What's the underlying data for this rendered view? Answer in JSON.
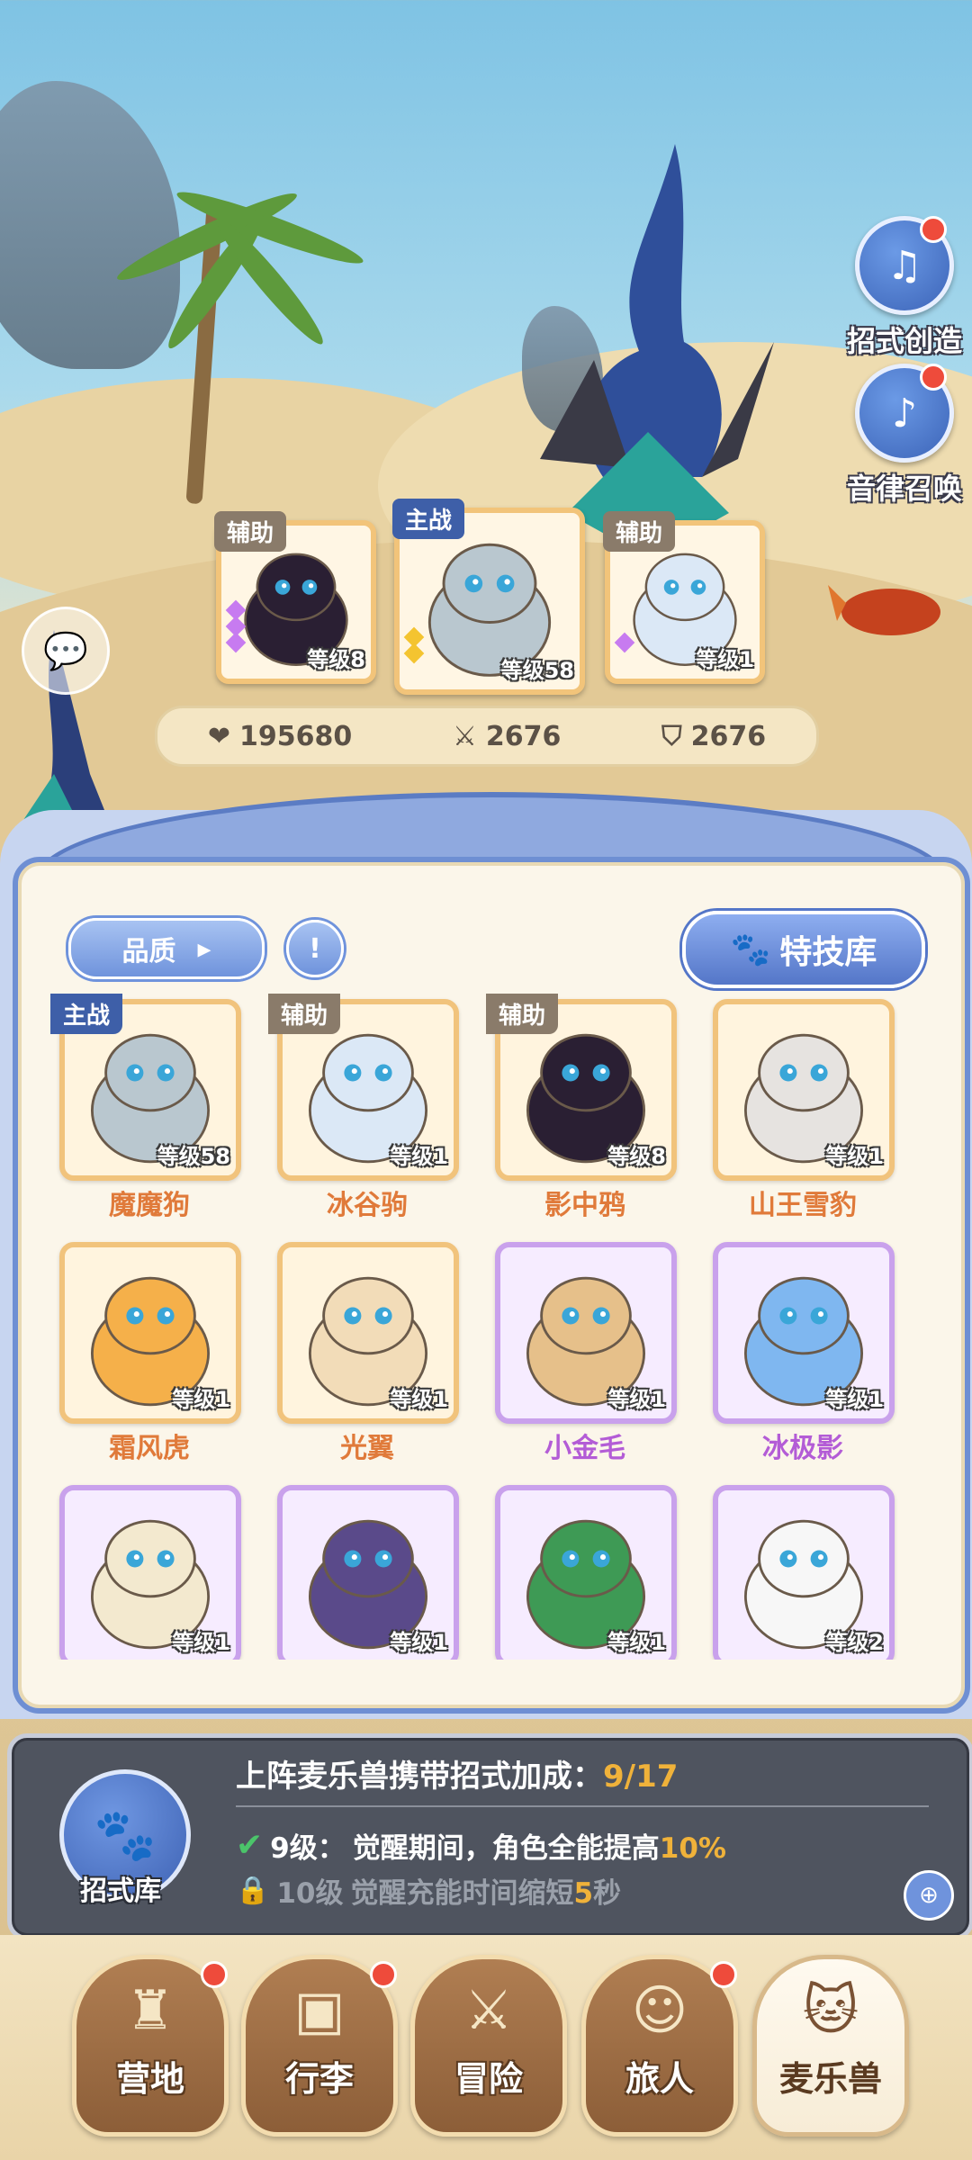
{
  "side_buttons": [
    {
      "label": "招式创造",
      "icon": "music-book-icon"
    },
    {
      "label": "音律召唤",
      "icon": "lyre-icon"
    }
  ],
  "team": [
    {
      "role": "辅助",
      "level_text": "等级8",
      "level": 8,
      "stars": 3,
      "star_color": "#c77bf0",
      "color": "#2a1f33"
    },
    {
      "role": "主战",
      "level_text": "等级58",
      "level": 58,
      "stars": 2,
      "star_color": "#f4c430",
      "color": "#b9c7cf"
    },
    {
      "role": "辅助",
      "level_text": "等级1",
      "level": 1,
      "stars": 1,
      "star_color": "#c77bf0",
      "color": "#dbe8f6"
    }
  ],
  "stats": {
    "hp": "195680",
    "attack": "2676",
    "defense": "2676"
  },
  "filter": {
    "quality_label": "品质",
    "skill_library_label": "特技库"
  },
  "pets": [
    {
      "name": "魔魔狗",
      "tag": "主战",
      "level_text": "等级58",
      "rarity": "gold",
      "color": "#b9c7cf"
    },
    {
      "name": "冰谷驹",
      "tag": "辅助",
      "level_text": "等级1",
      "rarity": "gold",
      "color": "#dbe8f6"
    },
    {
      "name": "影中鸦",
      "tag": "辅助",
      "level_text": "等级8",
      "rarity": "gold",
      "color": "#2a1f33"
    },
    {
      "name": "山王雪豹",
      "tag": "",
      "level_text": "等级1",
      "rarity": "gold",
      "color": "#e6e3e0"
    },
    {
      "name": "霜风虎",
      "tag": "",
      "level_text": "等级1",
      "rarity": "gold",
      "color": "#f5b04a"
    },
    {
      "name": "光翼",
      "tag": "",
      "level_text": "等级1",
      "rarity": "gold",
      "color": "#f2dcb8"
    },
    {
      "name": "小金毛",
      "tag": "",
      "level_text": "等级1",
      "rarity": "purple",
      "color": "#e6c08a"
    },
    {
      "name": "冰极影",
      "tag": "",
      "level_text": "等级1",
      "rarity": "purple",
      "color": "#7fb7f0"
    },
    {
      "name": "",
      "tag": "",
      "level_text": "等级1",
      "rarity": "purple",
      "color": "#f3e9cf"
    },
    {
      "name": "",
      "tag": "",
      "level_text": "等级1",
      "rarity": "purple",
      "color": "#5a4a8a"
    },
    {
      "name": "",
      "tag": "",
      "level_text": "等级1",
      "rarity": "purple",
      "color": "#3e9a55"
    },
    {
      "name": "",
      "tag": "",
      "level_text": "等级2",
      "rarity": "purple",
      "color": "#f7f7f7"
    }
  ],
  "bonus_panel": {
    "icon_label": "招式库",
    "title": "上阵麦乐兽携带招式加成：",
    "count": "9/17",
    "active": {
      "level": "9级：",
      "text_before": "觉醒期间，角色全能提高",
      "value": "10%",
      "text_after": ""
    },
    "locked": {
      "level": "10级",
      "text_before": "觉醒充能时间缩短",
      "value": "5",
      "text_after": "秒"
    }
  },
  "nav": [
    {
      "label": "营地",
      "badge": true,
      "active": false,
      "icon": "castle-icon"
    },
    {
      "label": "行李",
      "badge": true,
      "active": false,
      "icon": "luggage-icon"
    },
    {
      "label": "冒险",
      "badge": false,
      "active": false,
      "icon": "crossed-swords-icon"
    },
    {
      "label": "旅人",
      "badge": true,
      "active": false,
      "icon": "traveler-icon"
    },
    {
      "label": "麦乐兽",
      "badge": false,
      "active": true,
      "icon": "pet-cat-icon"
    }
  ],
  "colors": {
    "accent": "#5476c8",
    "gold_border": "#f1c37c",
    "purple_border": "#c9a1ec",
    "highlight": "#f0b23a",
    "badge": "#ee4b3b"
  }
}
